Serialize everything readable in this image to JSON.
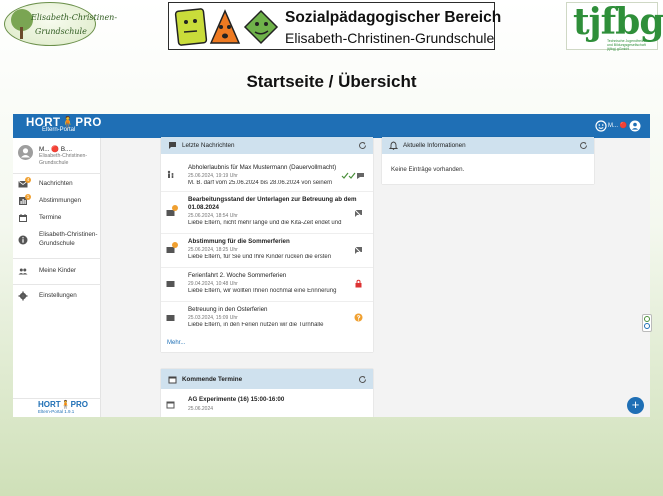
{
  "header": {
    "school_logo_line1": "Elisabeth-Christinen-",
    "school_logo_line2": "Grundschule",
    "banner_title": "Sozialpädagogischer Bereich",
    "banner_subtitle": "Elisabeth-Christinen-Grundschule",
    "partner_logo_text": "tjfbg",
    "partner_logo_small": "Technische Jugendfreizeit- und Bildungsgesellschaft (tjfbg) gGmbH"
  },
  "page_title": "Startseite / Übersicht",
  "app": {
    "brand_name": "HORT🧍PRO",
    "brand_sub": "Eltern-Portal",
    "top_user_label": "M... 🔴",
    "user": {
      "name": "M... 🔴 B....",
      "school_line1": "Elisabeth-Christinen-",
      "school_line2": "Grundschule"
    },
    "sidebar": [
      {
        "label": "Nachrichten",
        "badge": "4"
      },
      {
        "label": "Abstimmungen",
        "badge": "1"
      },
      {
        "label": "Termine"
      },
      {
        "label_line1": "Elisabeth-Christinen-",
        "label_line2": "Grundschule"
      },
      {
        "label": "Meine Kinder"
      },
      {
        "label": "Einstellungen"
      }
    ],
    "footer_brand": "HORT🧍PRO",
    "footer_version": "Eltern-Portal 1.9.1",
    "messages_card": {
      "title": "Letzte Nachrichten",
      "more": "Mehr...",
      "items": [
        {
          "title": "Abholerlaubnis für Max Mustermann (Dauervollmacht)",
          "date": "25.06.2024, 19:19 Uhr",
          "preview": "M. B. darf vom 25.06.2024 bis 28.06.2024 von seinem"
        },
        {
          "title_line1": "Bearbeitungsstand der Unterlagen zur Betreuung ab dem",
          "title_line2": "01.08.2024",
          "date": "25.06.2024, 18:54 Uhr",
          "preview": "Liebe Eltern, nicht mehr lange und die Kita-Zeit endet und"
        },
        {
          "title": "Abstimmung für die Sommerferien",
          "date": "25.06.2024, 18:25 Uhr",
          "preview": "Liebe Eltern, für Sie und Ihre Kinder rücken die ersten"
        },
        {
          "title": "Ferienfahrt 2. Woche Sommerferien",
          "date": "29.04.2024, 10:48 Uhr",
          "preview": "Liebe Eltern, wir wollten Ihnen nochmal eine Erinnerung"
        },
        {
          "title": "Betreuung in den Osterferien",
          "date": "25.03.2024, 15:09 Uhr",
          "preview": "Liebe Eltern, in den Ferien nutzen wir die Turnhalle"
        }
      ]
    },
    "info_card": {
      "title": "Aktuelle Informationen",
      "empty": "Keine Einträge vorhanden."
    },
    "events_card": {
      "title": "Kommende Termine",
      "event_title": "AG Experimente (16) 15:00-16:00",
      "event_date": "25.06.2024"
    },
    "colors": {
      "topbar": "#1f6fb5",
      "card_header": "#cfe1ee",
      "badge": "#f0a030"
    }
  }
}
